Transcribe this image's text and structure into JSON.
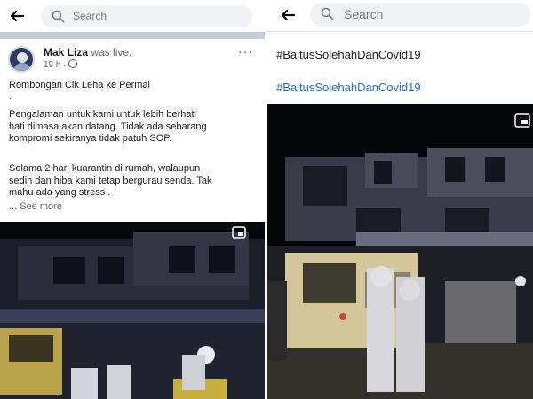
{
  "left": {
    "search": {
      "placeholder": "Search"
    },
    "post": {
      "author_name": "Mak Liza",
      "action": "was live.",
      "time": "19 h ·",
      "more": "···",
      "lines": [
        "Rombongan Cik Leha ke Permai",
        ".",
        "Pengalaman untuk kami untuk lebih berhati",
        "hati dimasa akan datang. Tidak ada sebarang",
        "kompromi sekiranya tidak patuh SOP.",
        "Selama 2 hari kuarantin di rumah, walaupun",
        "sedih dan hiba kami tetap bergurau senda.  Tak",
        "mahu ada yang stress ."
      ],
      "see_more": "... See more"
    }
  },
  "right": {
    "search": {
      "placeholder": "Search"
    },
    "hashtag_text": "#BaitusSolehahDanCovid19",
    "hashtag_link": "#BaitusSolehahDanCovid19"
  },
  "colors": {
    "link": "#216fdb",
    "card": "#ffffff",
    "gap": "#c9ccd1"
  }
}
